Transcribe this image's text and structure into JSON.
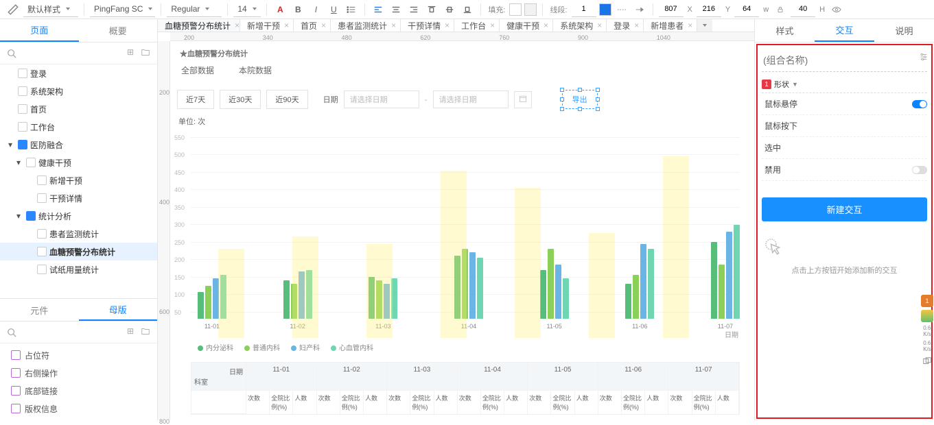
{
  "toolbar": {
    "style_preset": "默认样式",
    "font_family": "PingFang SC",
    "font_weight": "Regular",
    "font_size": "14",
    "fill_label": "填充:",
    "stroke_label": "线段:",
    "stroke_width": "1",
    "pos_x": "807",
    "pos_y": "216",
    "size_w": "64",
    "size_h": "40",
    "x_lbl": "X",
    "y_lbl": "Y",
    "w_lbl": "w",
    "h_lbl": "H"
  },
  "left": {
    "tab_page": "页面",
    "tab_outline": "概要",
    "tree": {
      "login": "登录",
      "arch": "系统架构",
      "home": "首页",
      "workbench": "工作台",
      "medical": "医防融合",
      "health": "健康干预",
      "new_int": "新增干预",
      "int_detail": "干预详情",
      "stats": "统计分析",
      "patient_mon": "患者监测统计",
      "blood_alarm": "血糖预警分布统计",
      "strip_usage": "试纸用量统计"
    },
    "tab_components": "元件",
    "tab_master": "母版",
    "libs": {
      "placeholder": "占位符",
      "right_op": "右侧操作",
      "bottom_link": "底部链接",
      "copyright": "版权信息"
    }
  },
  "doctabs": {
    "t0": "血糖预警分布统计",
    "t1": "新增干预",
    "t2": "首页",
    "t3": "患者监测统计",
    "t4": "干预详情",
    "t5": "工作台",
    "t6": "健康干预",
    "t7": "系统架构",
    "t8": "登录",
    "t9": "新增患者"
  },
  "canvas_page": {
    "title_fragment": "★血糖预警分布统计",
    "tab_all": "全部数据",
    "tab_local": "本院数据",
    "btn7": "近7天",
    "btn30": "近30天",
    "btn90": "近90天",
    "date_label": "日期",
    "date_placeholder": "请选择日期",
    "export": "导出",
    "unit": "单位: 次",
    "x_axis_label": "日期",
    "table_header_date": "日期",
    "table_header_dept": "科室",
    "col_times": "次数",
    "col_ratio": "全院比例(%)",
    "col_people": "人数"
  },
  "right": {
    "tab_style": "样式",
    "tab_interact": "交互",
    "tab_note": "说明",
    "group_name_placeholder": "(组合名称)",
    "shape_label": "形状",
    "state_hover": "鼠标悬停",
    "state_pressed": "鼠标按下",
    "state_selected": "选中",
    "state_disabled": "禁用",
    "new_btn": "新建交互",
    "hint": "点击上方按钮开始添加新的交互"
  },
  "chart_data": {
    "type": "bar",
    "title": "",
    "xlabel": "日期",
    "ylabel": "",
    "ylim": [
      0,
      550
    ],
    "categories": [
      "11-01",
      "11-02",
      "11-03",
      "11-04",
      "11-05",
      "11-06",
      "11-07"
    ],
    "series": [
      {
        "name": "内分泌科",
        "color": "#56bd7a",
        "values": [
          77,
          110,
          120,
          180,
          140,
          100,
          220
        ]
      },
      {
        "name": "普通内科",
        "color": "#8bd159",
        "values": [
          95,
          100,
          110,
          200,
          200,
          125,
          155
        ]
      },
      {
        "name": "妇产科",
        "color": "#6bb4e6",
        "values": [
          115,
          135,
          100,
          190,
          155,
          215,
          250
        ]
      },
      {
        "name": "心血管内科",
        "color": "#6ed6b0",
        "values": [
          125,
          140,
          115,
          175,
          115,
          200,
          270
        ]
      }
    ],
    "ghost_values": [
      255,
      290,
      270,
      480,
      430,
      300,
      520
    ]
  }
}
